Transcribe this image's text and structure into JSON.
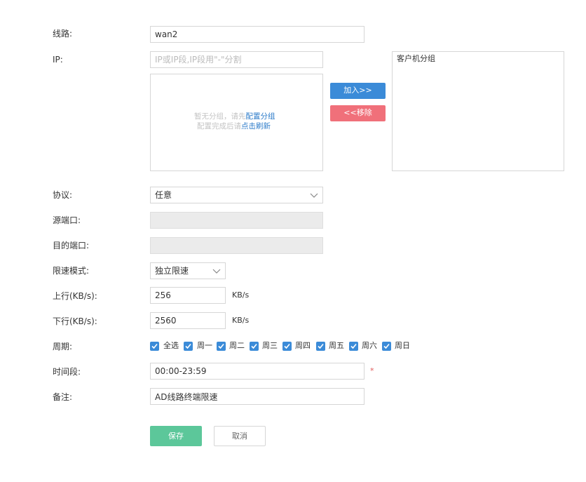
{
  "form": {
    "line": {
      "label": "线路:",
      "value": "wan2"
    },
    "ip": {
      "label": "IP:",
      "placeholder": "IP或IP段,IP段用\"-\"分割",
      "empty_text_1": "暂无分组，请先",
      "empty_link_1": "配置分组",
      "empty_text_2": "配置完成后请",
      "empty_link_2": "点击刷新",
      "add_button": "加入>>",
      "remove_button": "<<移除",
      "group_title": "客户机分组"
    },
    "protocol": {
      "label": "协议:",
      "value": "任意"
    },
    "src_port": {
      "label": "源端口:",
      "value": ""
    },
    "dst_port": {
      "label": "目的端口:",
      "value": ""
    },
    "rate_mode": {
      "label": "限速模式:",
      "value": "独立限速"
    },
    "upload": {
      "label": "上行(KB/s):",
      "value": "256",
      "unit": "KB/s"
    },
    "download": {
      "label": "下行(KB/s):",
      "value": "2560",
      "unit": "KB/s"
    },
    "period": {
      "label": "周期:",
      "options": [
        "全选",
        "周一",
        "周二",
        "周三",
        "周四",
        "周五",
        "周六",
        "周日"
      ]
    },
    "time_range": {
      "label": "时间段:",
      "value": "00:00-23:59",
      "required": "*"
    },
    "remark": {
      "label": "备注:",
      "value": "AD线路终端限速"
    },
    "save_button": "保存",
    "cancel_button": "取消"
  },
  "colors": {
    "primary": "#3b8bd8",
    "danger": "#f0707a",
    "save": "#5cc79a",
    "link": "#2c7bc9"
  }
}
